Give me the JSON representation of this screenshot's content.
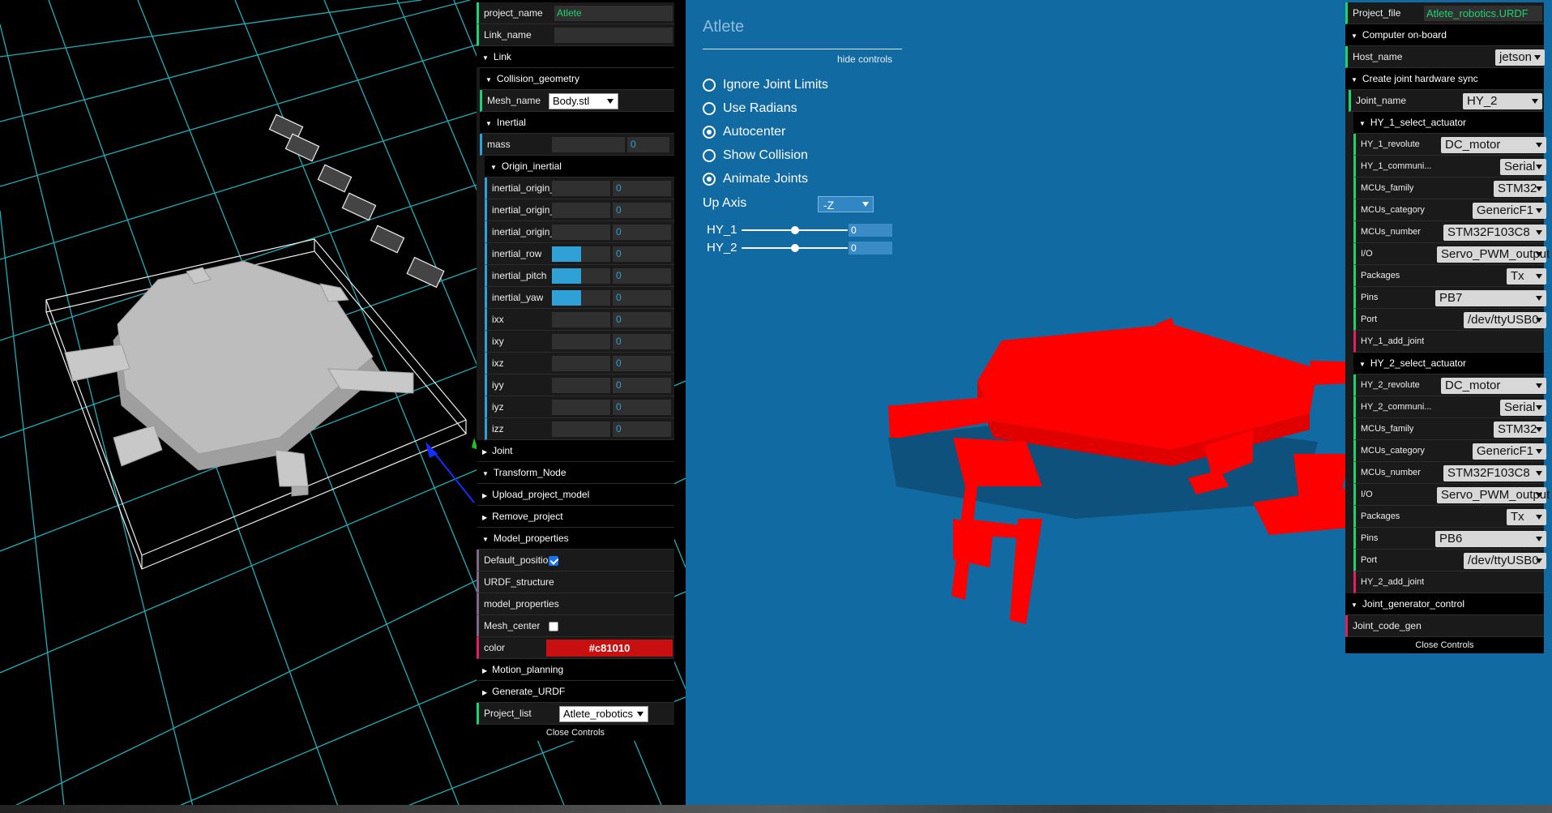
{
  "left_panel": {
    "project_name": {
      "label": "project_name",
      "value": "Atlete"
    },
    "link_name": {
      "label": "Link_name",
      "value": ""
    },
    "link_folder": "Link",
    "collision_geometry": "Collision_geometry",
    "mesh_name": {
      "label": "Mesh_name",
      "value": "Body.stl"
    },
    "inertial_folder": "Inertial",
    "mass": {
      "label": "mass",
      "value": "0"
    },
    "origin_inertial": "Origin_inertial",
    "inertial_params": [
      {
        "label": "inertial_origin_x",
        "value": "0",
        "fill": 0
      },
      {
        "label": "inertial_origin_y",
        "value": "0",
        "fill": 0
      },
      {
        "label": "inertial_origin_z",
        "value": "0",
        "fill": 0
      },
      {
        "label": "inertial_row",
        "value": "0",
        "fill": 0.5
      },
      {
        "label": "inertial_pitch",
        "value": "0",
        "fill": 0.5
      },
      {
        "label": "inertial_yaw",
        "value": "0",
        "fill": 0.5
      },
      {
        "label": "ixx",
        "value": "0",
        "fill": 0
      },
      {
        "label": "ixy",
        "value": "0",
        "fill": 0
      },
      {
        "label": "ixz",
        "value": "0",
        "fill": 0
      },
      {
        "label": "iyy",
        "value": "0",
        "fill": 0
      },
      {
        "label": "iyz",
        "value": "0",
        "fill": 0
      },
      {
        "label": "izz",
        "value": "0",
        "fill": 0
      }
    ],
    "joint": "Joint",
    "transform_node": "Transform_Node",
    "upload_project_model": "Upload_project_model",
    "remove_project": "Remove_project",
    "model_properties": "Model_properties",
    "default_position": {
      "label": "Default_position",
      "checked": true
    },
    "urdf_structure": "URDF_structure",
    "model_properties_item": "model_properties",
    "mesh_center": {
      "label": "Mesh_center",
      "checked": false
    },
    "color": {
      "label": "color",
      "value": "#c81010"
    },
    "motion_planning": "Motion_planning",
    "generate_urdf": "Generate_URDF",
    "project_list": {
      "label": "Project_list",
      "value": "Atlete_robotics"
    },
    "close": "Close Controls"
  },
  "viewer": {
    "title": "Atlete",
    "hide_controls": "hide controls",
    "options": [
      {
        "label": "Ignore Joint Limits",
        "checked": false
      },
      {
        "label": "Use Radians",
        "checked": false
      },
      {
        "label": "Autocenter",
        "checked": true
      },
      {
        "label": "Show Collision",
        "checked": false
      },
      {
        "label": "Animate Joints",
        "checked": true
      }
    ],
    "up_axis": {
      "label": "Up Axis",
      "value": "-Z"
    },
    "joints": [
      {
        "label": "HY_1",
        "value": "0",
        "position": 0.5
      },
      {
        "label": "HY_2",
        "value": "0",
        "position": 0.5
      }
    ],
    "robot_color": "#ff0000",
    "background_color": "#116aa1"
  },
  "right_panel": {
    "project_file": {
      "label": "Project_file",
      "value": "Atlete_robotics.URDF"
    },
    "computer_onboard": "Computer on-board",
    "host_name": {
      "label": "Host_name",
      "value": "jetson"
    },
    "create_joint_sync": "Create joint hardware sync",
    "joint_name": {
      "label": "Joint_name",
      "value": "HY_2"
    },
    "hy1": {
      "folder": "HY_1_select_actuator",
      "revolute": {
        "label": "HY_1_revolute",
        "value": "DC_motor"
      },
      "communi": {
        "label": "HY_1_communi...",
        "value": "Serial"
      },
      "family": {
        "label": "MCUs_family",
        "value": "STM32"
      },
      "category": {
        "label": "MCUs_category",
        "value": "GenericF1"
      },
      "number": {
        "label": "MCUs_number",
        "value": "STM32F103C8"
      },
      "io": {
        "label": "I/O",
        "value": "Servo_PWM_output"
      },
      "packages": {
        "label": "Packages",
        "value": "Tx"
      },
      "pins": {
        "label": "Pins",
        "value": "PB7"
      },
      "port": {
        "label": "Port",
        "value": "/dev/ttyUSB0"
      },
      "add_joint": "HY_1_add_joint"
    },
    "hy2": {
      "folder": "HY_2_select_actuator",
      "revolute": {
        "label": "HY_2_revolute",
        "value": "DC_motor"
      },
      "communi": {
        "label": "HY_2_communi...",
        "value": "Serial"
      },
      "family": {
        "label": "MCUs_family",
        "value": "STM32"
      },
      "category": {
        "label": "MCUs_category",
        "value": "GenericF1"
      },
      "number": {
        "label": "MCUs_number",
        "value": "STM32F103C8"
      },
      "io": {
        "label": "I/O",
        "value": "Servo_PWM_output"
      },
      "packages": {
        "label": "Packages",
        "value": "Tx"
      },
      "pins": {
        "label": "Pins",
        "value": "PB6"
      },
      "port": {
        "label": "Port",
        "value": "/dev/ttyUSB0"
      },
      "add_joint": "HY_2_add_joint"
    },
    "joint_generator_control": "Joint_generator_control",
    "joint_code_gen": "Joint_code_gen",
    "close": "Close Controls"
  }
}
